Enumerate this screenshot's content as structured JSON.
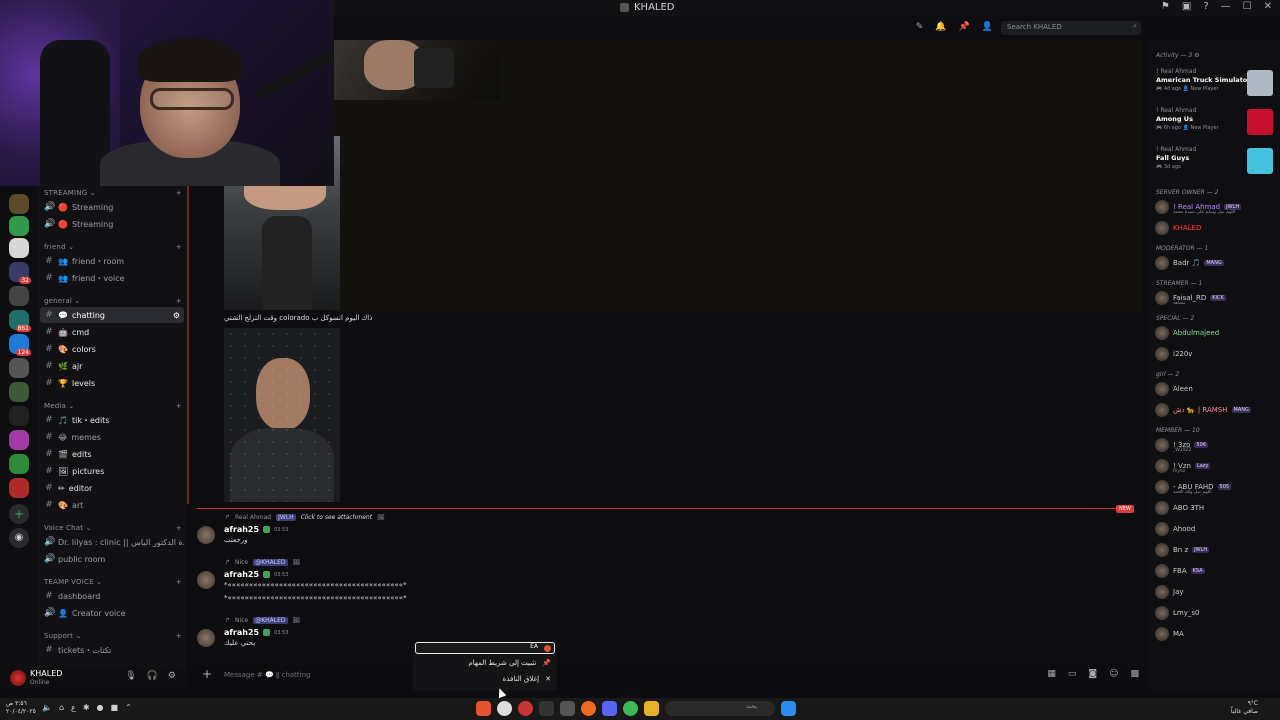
{
  "window": {
    "title": "KHALED",
    "search_placeholder": "Search KHALED"
  },
  "colors": {
    "accent": "#5865f2",
    "new_line": "#e03b3b",
    "online": "#3ba55c",
    "mention_bg": "#3c3f7a"
  },
  "sidebar": {
    "categories": [
      {
        "label": "STREAMING ⌄",
        "top": 0
      },
      {
        "label": "friend ⌄"
      },
      {
        "label": "general ⌄"
      },
      {
        "label": "Media ⌄"
      },
      {
        "label": "Voice Chat ⌄"
      },
      {
        "label": "TEAMP VOICE ⌄"
      },
      {
        "label": "Support ⌄"
      }
    ],
    "channels": [
      {
        "name": "Streaming",
        "emoji": "🔊"
      },
      {
        "name": "Streaming",
        "emoji": "🔊"
      },
      {
        "name": "friend・room",
        "emoji": "#"
      },
      {
        "name": "friend・voice",
        "emoji": "#"
      },
      {
        "name": "chatting",
        "emoji": "💬"
      },
      {
        "name": "cmd",
        "emoji": "🤖"
      },
      {
        "name": "colors",
        "emoji": "🎨"
      },
      {
        "name": "ajr",
        "emoji": "🌿"
      },
      {
        "name": "levels",
        "emoji": "🏆"
      },
      {
        "name": "tik・edits",
        "emoji": "🎵"
      },
      {
        "name": "memes",
        "emoji": "😂"
      },
      {
        "name": "edits",
        "emoji": "🎬"
      },
      {
        "name": "pictures",
        "emoji": "🖼"
      },
      {
        "name": "editor",
        "emoji": "✏"
      },
      {
        "name": "art",
        "emoji": "🎨"
      },
      {
        "name": "Dr. lilyas : clinic || عيادة الدكتور الياس",
        "emoji": "🔊"
      },
      {
        "name": "public room",
        "emoji": "🔊"
      },
      {
        "name": "dashboard",
        "emoji": "#"
      },
      {
        "name": "Creator voice",
        "emoji": "🔊"
      },
      {
        "name": "tickets・تكتات",
        "emoji": "#"
      }
    ]
  },
  "user": {
    "name": "KHALED",
    "status": "Online"
  },
  "chat": {
    "caption": "ذاك اليوم اتسوكل ب colorado وقت التزلج الشتي",
    "new_tag": "NEW",
    "messages": [
      {
        "reply_user": "Real Ahmad",
        "reply_tag": "JWLH",
        "reply_text": "Click to see attachment",
        "author": "afrah25",
        "time": "03:53",
        "body": "ورجعتب"
      },
      {
        "reply_user": "Nice",
        "reply_tag": "@KHALED",
        "reply_text": "",
        "author": "afrah25",
        "time": "03:53",
        "body": "*«««««««««««««««««««««««««««««««««««««««««*",
        "body2": "*«««««««««««««««««««««««««««««««««««««««««*"
      },
      {
        "reply_user": "Nice",
        "reply_tag": "@KHALED",
        "reply_text": "",
        "author": "afrah25",
        "time": "03:53",
        "body": "يحتي عليك"
      }
    ],
    "composer_placeholder": "Message # 💬 ǁ chatting"
  },
  "members": {
    "activity_header": "Activity — 3 ⚙",
    "activities": [
      {
        "who": "! Real Ahmad",
        "game": "American Truck Simulator",
        "meta": "🎮 4d ago  👤 New Player",
        "color": "#b0b8c4"
      },
      {
        "who": "! Real Ahmad",
        "game": "Among Us",
        "meta": "🎮 6h ago  👤 New Player",
        "color": "#c8102e"
      },
      {
        "who": "! Real Ahmad",
        "game": "Fall Guys",
        "meta": "🎮 3d ago",
        "color": "#44c2e0"
      }
    ],
    "groups": [
      {
        "header": "SERVER OWNER — 2",
        "items": [
          {
            "name": "! Real Ahmad",
            "tag": "JWLH",
            "sub": "اللهم صل وسلم على سيدنا محمد",
            "color": "#b48cff"
          },
          {
            "name": "KHALED",
            "tag": "",
            "sub": "",
            "color": "#ff4040"
          }
        ]
      },
      {
        "header": "MODERATOR — 1",
        "items": [
          {
            "name": "Badr 🎵",
            "tag": "MANG",
            "sub": "",
            "color": "#c9ccd0"
          }
        ]
      },
      {
        "header": "STREAMER — 1",
        "items": [
          {
            "name": "Faisal_RD",
            "tag": "KICK",
            "sub": "مشاهد",
            "color": "#c9ccd0"
          }
        ]
      },
      {
        "header": "SPECIAL — 2",
        "items": [
          {
            "name": "Abdulmajeed",
            "tag": "",
            "sub": "",
            "color": "#7be3a0"
          },
          {
            "name": "i220v",
            "tag": "",
            "sub": "",
            "color": "#c9ccd0"
          }
        ]
      },
      {
        "header": "girl — 2",
        "items": [
          {
            "name": "Aleen",
            "tag": "",
            "sub": "",
            "color": "#c9ccd0"
          },
          {
            "name": "دش 🐆 | RAMSH",
            "tag": "MANG",
            "sub": "",
            "color": "#ff8f8f"
          }
        ]
      },
      {
        "header": "MEMBER — 10",
        "items": [
          {
            "name": "! 3zo",
            "tag": "506",
            "sub": "_W10ZZ",
            "color": "#c9ccd0"
          },
          {
            "name": "! Vzn",
            "tag": "Lazy",
            "sub": "Riyez",
            "color": "#c9ccd0"
          },
          {
            "name": "- ABU FAHD",
            "tag": "505",
            "sub": "اللهم صل ولله الحمد",
            "color": "#c9ccd0"
          },
          {
            "name": "ABO 3TH",
            "tag": "",
            "sub": "",
            "color": "#c9ccd0"
          },
          {
            "name": "Ahood",
            "tag": "",
            "sub": "",
            "color": "#c9ccd0"
          },
          {
            "name": "Bn z",
            "tag": "JWLH",
            "sub": "",
            "color": "#c9ccd0"
          },
          {
            "name": "FBA",
            "tag": "KSA",
            "sub": "",
            "color": "#c9ccd0"
          },
          {
            "name": "Jay",
            "tag": "",
            "sub": "",
            "color": "#c9ccd0"
          },
          {
            "name": "Lmy_s0",
            "tag": "",
            "sub": "",
            "color": "#c9ccd0"
          },
          {
            "name": "MA",
            "tag": "",
            "sub": "",
            "color": "#c9ccd0"
          }
        ]
      }
    ]
  },
  "context_menu": {
    "header": "EA",
    "items": [
      {
        "label": "تثبيت إلى شريط المهام",
        "icon": "pin-icon"
      },
      {
        "label": "إغلاق النافذة",
        "icon": "close-icon"
      }
    ]
  },
  "taskbar": {
    "time": "٣:٥٦ ص",
    "date": "٢٠/٠٤/٢٠٢٥",
    "search_label": "بحث",
    "weather": "٩°C",
    "weather_sub": "صافي غالباً"
  }
}
